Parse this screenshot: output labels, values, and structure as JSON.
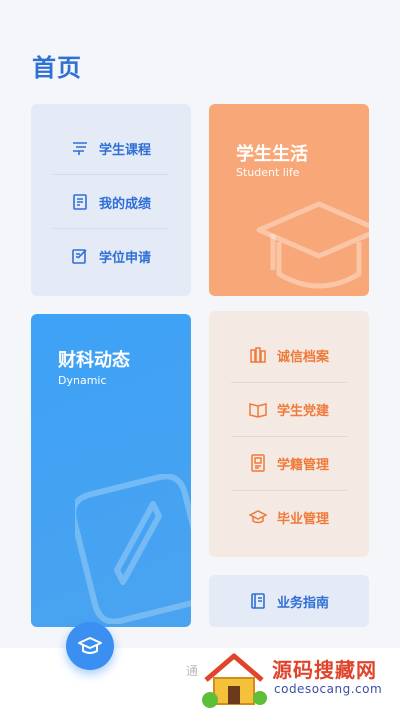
{
  "header": {
    "title": "首页"
  },
  "services": {
    "items": [
      {
        "label": "学生课程",
        "icon": "course-icon"
      },
      {
        "label": "我的成绩",
        "icon": "grades-icon"
      },
      {
        "label": "学位申请",
        "icon": "application-icon"
      }
    ]
  },
  "student_life": {
    "title": "学生生活",
    "subtitle": "Student life",
    "icon": "graduation-cap-icon"
  },
  "dynamic": {
    "title": "财科动态",
    "subtitle": "Dynamic",
    "icon": "compass-icon"
  },
  "archives": {
    "items": [
      {
        "label": "诚信档案",
        "icon": "books-icon"
      },
      {
        "label": "学生党建",
        "icon": "open-book-icon"
      },
      {
        "label": "学籍管理",
        "icon": "id-card-icon"
      },
      {
        "label": "毕业管理",
        "icon": "cap-icon"
      }
    ]
  },
  "guide": {
    "label": "业务指南",
    "icon": "guide-book-icon"
  },
  "fab": {
    "icon": "graduation-cap-icon"
  },
  "watermark": {
    "title": "源码搜藏网",
    "url": "codesocang.com",
    "left_text": "通"
  },
  "colors": {
    "accent_blue": "#2f6fd6",
    "accent_orange": "#ef7a3a",
    "life_card": "#f8a878",
    "dynamic_card": "#3ea2f6"
  }
}
